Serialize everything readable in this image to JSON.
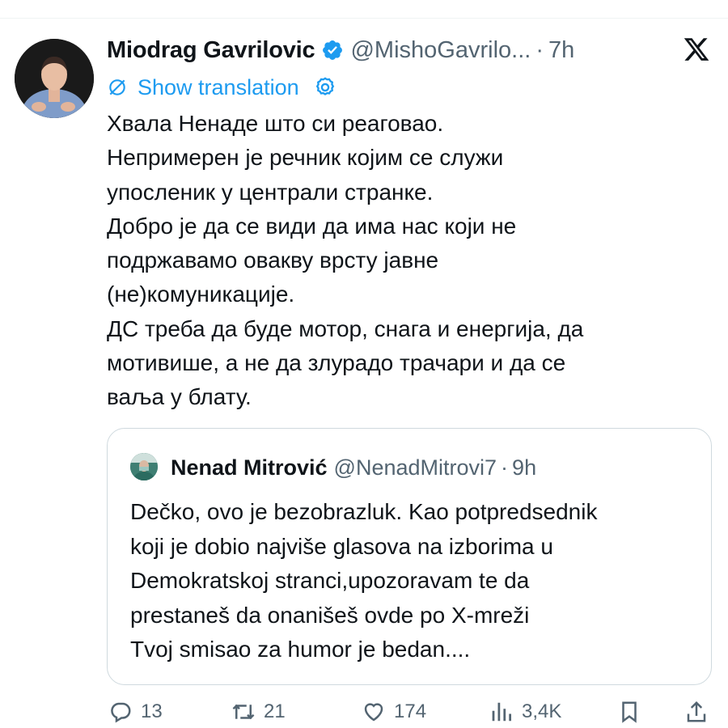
{
  "tweet": {
    "author_name": "Miodrag Gavrilovic",
    "author_handle": "@MishoGavrilo...",
    "separator": "·",
    "time": "7h",
    "translate_label": "Show translation",
    "text_lines": [
      "Хвала Ненаде што си реаговао.",
      "Непримерен је речник којим се служи",
      "упосленик у централи странке.",
      "Добро је да се види да има нас који не",
      "подржавамо овакву врсту јавне",
      "(не)комуникације.",
      "ДС треба да буде мотор, снага и енергија, да",
      "мотивише, а не да злурадо трачари и да се",
      "ваља у блату."
    ]
  },
  "quote": {
    "author_name": "Nenad Mitrović",
    "author_handle": "@NenadMitrovi7",
    "separator": "·",
    "time": "9h",
    "text_lines": [
      "Dečko, ovo je bezobrazluk. Kao potpredsednik",
      "koji je dobio najviše glasova na izborima u",
      "Demokratskoj stranci,upozoravam te da",
      "prestaneš da onanišeš ovde po X-mreži",
      "Tvoj smisao za humor je bedan...."
    ]
  },
  "actions": {
    "replies": "13",
    "retweets": "21",
    "likes": "174",
    "views": "3,4K"
  },
  "colors": {
    "accent": "#1d9bf0",
    "muted": "#536471",
    "text": "#0f1419",
    "border": "#cfd9de"
  },
  "icons": [
    "verified-badge-icon",
    "x-logo-icon",
    "translate-icon",
    "gear-icon",
    "reply-icon",
    "retweet-icon",
    "like-icon",
    "views-icon",
    "bookmark-icon",
    "share-icon"
  ]
}
